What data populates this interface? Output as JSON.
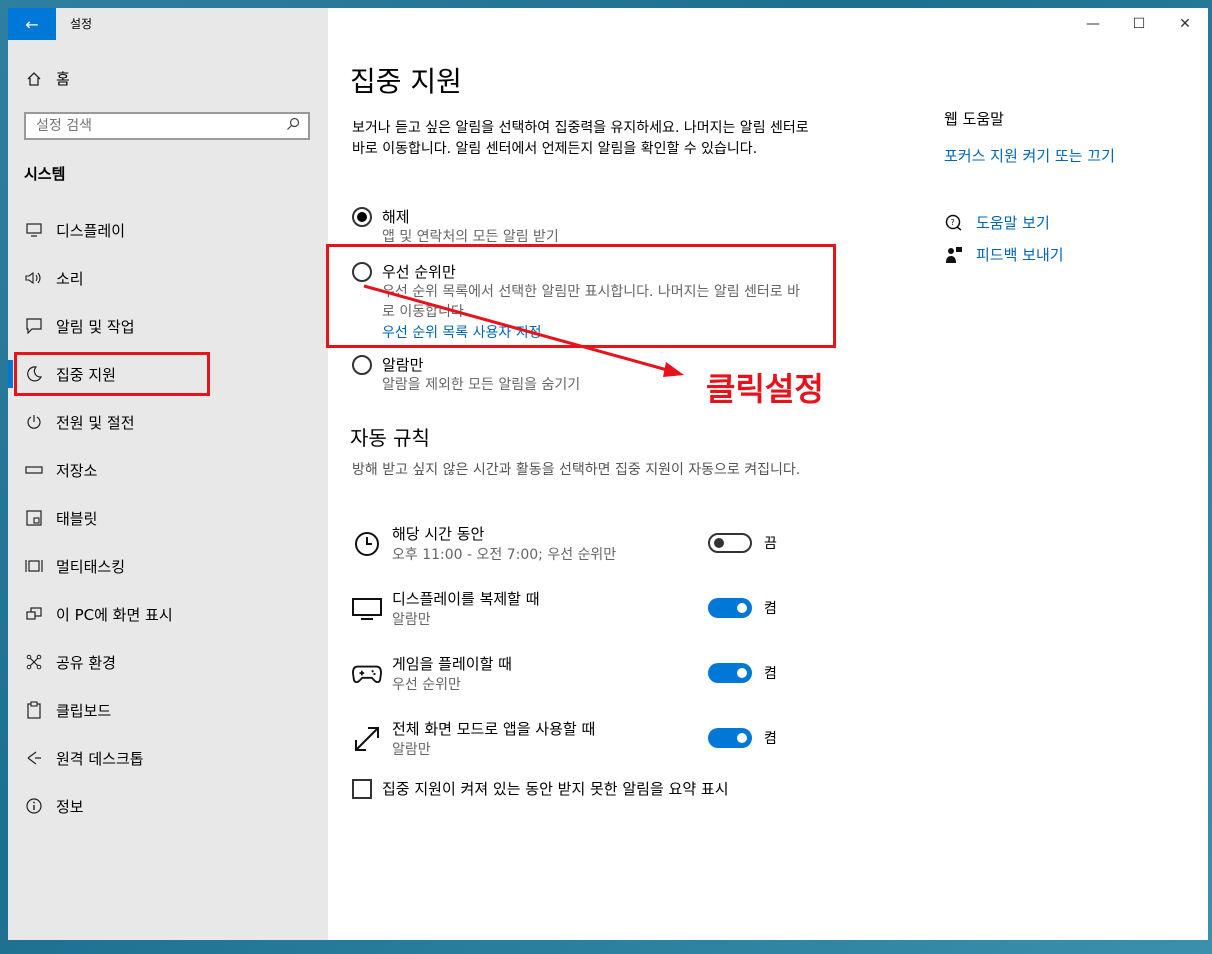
{
  "window": {
    "title": "설정",
    "controls": {
      "minimize": "—",
      "maximize": "☐",
      "close": "✕"
    }
  },
  "sidebar": {
    "home_label": "홈",
    "search_placeholder": "설정 검색",
    "section": "시스템",
    "items": [
      {
        "label": "디스플레이",
        "icon": "monitor-icon"
      },
      {
        "label": "소리",
        "icon": "speaker-icon"
      },
      {
        "label": "알림 및 작업",
        "icon": "notification-icon"
      },
      {
        "label": "집중 지원",
        "icon": "moon-icon",
        "active": true
      },
      {
        "label": "전원 및 절전",
        "icon": "power-icon"
      },
      {
        "label": "저장소",
        "icon": "storage-icon"
      },
      {
        "label": "태블릿",
        "icon": "tablet-icon"
      },
      {
        "label": "멀티태스킹",
        "icon": "multitasking-icon"
      },
      {
        "label": "이 PC에 화면 표시",
        "icon": "project-icon"
      },
      {
        "label": "공유 환경",
        "icon": "shared-icon"
      },
      {
        "label": "클립보드",
        "icon": "clipboard-icon"
      },
      {
        "label": "원격 데스크톱",
        "icon": "remote-icon"
      },
      {
        "label": "정보",
        "icon": "info-icon"
      }
    ]
  },
  "main": {
    "title": "집중 지원",
    "description": "보거나 듣고 싶은 알림을 선택하여 집중력을 유지하세요. 나머지는 알림 센터로 바로 이동합니다. 알림 센터에서 언제든지 알림을 확인할 수 있습니다.",
    "options": [
      {
        "label": "해제",
        "sub": "앱 및 연락처의 모든 알림 받기",
        "checked": true
      },
      {
        "label": "우선 순위만",
        "sub": "우선 순위 목록에서 선택한 알림만 표시합니다. 나머지는 알림 센터로 바로 이동합니다.",
        "link": "우선 순위 목록 사용자 지정",
        "checked": false
      },
      {
        "label": "알람만",
        "sub": "알람을 제외한 모든 알림을 숨기기",
        "checked": false
      }
    ],
    "annotation": "클릭설정",
    "auto_rules_heading": "자동 규칙",
    "auto_rules_desc": "방해 받고 싶지 않은 시간과 활동을 선택하면 집중 지원이 자동으로 켜집니다.",
    "rules": [
      {
        "title": "해당 시간 동안",
        "sub": "오후 11:00 - 오전 7:00; 우선 순위만",
        "state": "끔",
        "on": false,
        "icon": "clock-icon"
      },
      {
        "title": "디스플레이를 복제할 때",
        "sub": "알람만",
        "state": "켬",
        "on": true,
        "icon": "monitor-icon"
      },
      {
        "title": "게임을 플레이할 때",
        "sub": "우선 순위만",
        "state": "켬",
        "on": true,
        "icon": "gamepad-icon"
      },
      {
        "title": "전체 화면 모드로 앱을 사용할 때",
        "sub": "알람만",
        "state": "켬",
        "on": true,
        "icon": "fullscreen-icon"
      }
    ],
    "summary_checkbox": "집중 지원이 켜져 있는 동안 받지 못한 알림을 요약 표시"
  },
  "help": {
    "web_help": "웹 도움말",
    "focus_link": "포커스 지원 켜기 또는 끄기",
    "get_help": "도움말 보기",
    "feedback": "피드백 보내기"
  },
  "colors": {
    "accent": "#0078d7",
    "link": "#0067b8",
    "annotation": "#e8121b",
    "sidebar_bg": "#e8e8e8"
  }
}
